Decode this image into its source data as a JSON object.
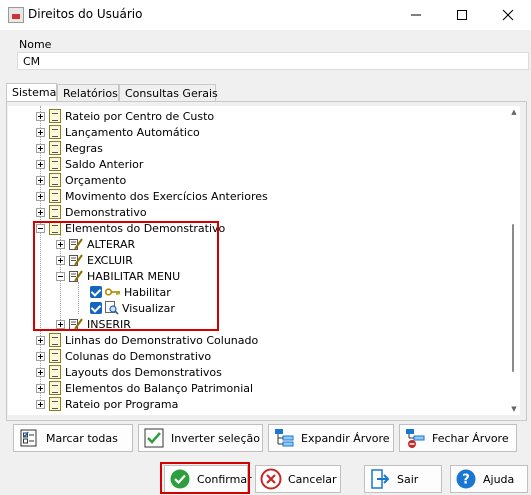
{
  "window": {
    "title": "Direitos do Usuário",
    "minimize_icon": "minimize-icon",
    "maximize_icon": "maximize-icon",
    "close_icon": "close-icon"
  },
  "form": {
    "nome_label": "Nome",
    "nome_value": "CM"
  },
  "tabs": [
    "Sistema",
    "Relatórios",
    "Consultas Gerais"
  ],
  "tree": {
    "items": [
      {
        "label": "Rateio por Centro de Custo"
      },
      {
        "label": "Lançamento Automático"
      },
      {
        "label": "Regras"
      },
      {
        "label": "Saldo Anterior"
      },
      {
        "label": "Orçamento"
      },
      {
        "label": "Movimento dos Exercícios Anteriores"
      },
      {
        "label": "Demonstrativo"
      },
      {
        "label": "Elementos do Demonstrativo"
      },
      {
        "label": "ALTERAR"
      },
      {
        "label": "EXCLUIR"
      },
      {
        "label": "HABILITAR MENU"
      },
      {
        "label": "Habilitar"
      },
      {
        "label": "Visualizar"
      },
      {
        "label": "INSERIR"
      },
      {
        "label": "Linhas do Demonstrativo Colunado"
      },
      {
        "label": "Colunas do Demonstrativo"
      },
      {
        "label": "Layouts dos Demonstrativos"
      },
      {
        "label": "Elementos do Balanço Patrimonial"
      },
      {
        "label": "Rateio por Programa"
      }
    ]
  },
  "actions": {
    "marcar_todas": "Marcar todas",
    "inverter_selecao": "Inverter seleção",
    "expandir_arvore": "Expandir Árvore",
    "fechar_arvore": "Fechar Árvore"
  },
  "footer": {
    "confirmar": "Confirmar",
    "cancelar": "Cancelar",
    "sair": "Sair",
    "ajuda": "Ajuda"
  },
  "colors": {
    "highlight": "#d40000",
    "checkbox": "#1565c0",
    "confirm_green": "#2e9e3e",
    "cancel_red": "#c62828",
    "help_blue": "#1976d2"
  }
}
